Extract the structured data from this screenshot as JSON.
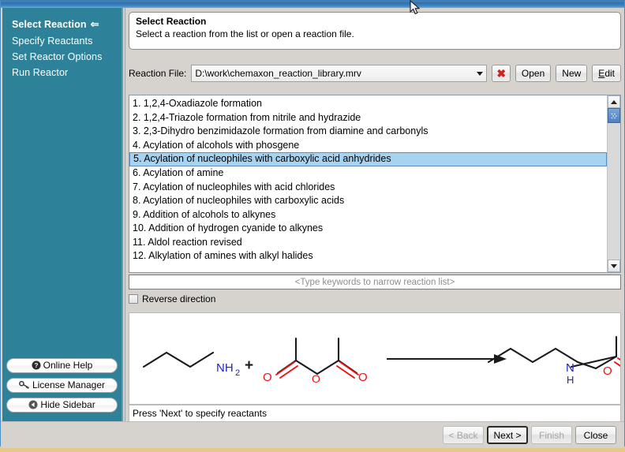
{
  "sidebar": {
    "nav_items": [
      {
        "label": "Select Reaction",
        "active": true,
        "arrow": "⇐"
      },
      {
        "label": "Specify Reactants",
        "active": false,
        "arrow": ""
      },
      {
        "label": "Set Reactor Options",
        "active": false,
        "arrow": ""
      },
      {
        "label": "Run Reactor",
        "active": false,
        "arrow": ""
      }
    ],
    "buttons": [
      {
        "label": "Online Help",
        "icon": "help-circle-icon"
      },
      {
        "label": "License Manager",
        "icon": "key-icon"
      },
      {
        "label": "Hide Sidebar",
        "icon": "collapse-left-icon"
      }
    ],
    "color": "#2d8198"
  },
  "header": {
    "title": "Select Reaction",
    "subtitle": "Select a reaction from the list or open a reaction file."
  },
  "file_row": {
    "label": "Reaction File:",
    "value": "D:\\work\\chemaxon_reaction_library.mrv",
    "clear_icon": "red-x-icon",
    "open_label": "Open",
    "new_label": "New",
    "edit_label": "Edit",
    "edit_mnemonic": "E",
    "edit_rest": "dit"
  },
  "reaction_list": {
    "selected_index": 4,
    "items": [
      "1. 1,2,4-Oxadiazole formation",
      "2. 1,2,4-Triazole formation from nitrile and hydrazide",
      "3. 2,3-Dihydro benzimidazole formation from diamine and carbonyls",
      "4. Acylation of alcohols with phosgene",
      "5. Acylation of nucleophiles with carboxylic acid anhydrides",
      "6. Acylation of amine",
      "7. Acylation of nucleophiles with acid chlorides",
      "8. Acylation of nucleophiles with carboxylic acids",
      "9. Addition of alcohols to alkynes",
      "10. Addition of hydrogen cyanide to alkynes",
      "11. Aldol reaction revised",
      "12. Alkylation of amines with alkyl halides"
    ],
    "selection_color": "#a8d3f0"
  },
  "search": {
    "placeholder": "<Type keywords to narrow reaction list>",
    "value": ""
  },
  "reverse_checkbox": {
    "label": "Reverse direction",
    "checked": false
  },
  "structure": {
    "plus_sign": "+",
    "reactant1_label": "NH",
    "reactant1_sub": "2",
    "product_n": "N",
    "product_h": "H",
    "oxygen_label": "O",
    "nitrogen_color": "#2222cc",
    "oxygen_color": "#ee1111",
    "bond_color": "#1a1a1a"
  },
  "status": {
    "text": "Press 'Next' to specify reactants"
  },
  "footer": {
    "buttons": [
      {
        "label": "< Back",
        "state": "disabled"
      },
      {
        "label": "Next >",
        "state": "focused"
      },
      {
        "label": "Finish",
        "state": "disabled"
      },
      {
        "label": "Close",
        "state": "normal"
      }
    ]
  }
}
